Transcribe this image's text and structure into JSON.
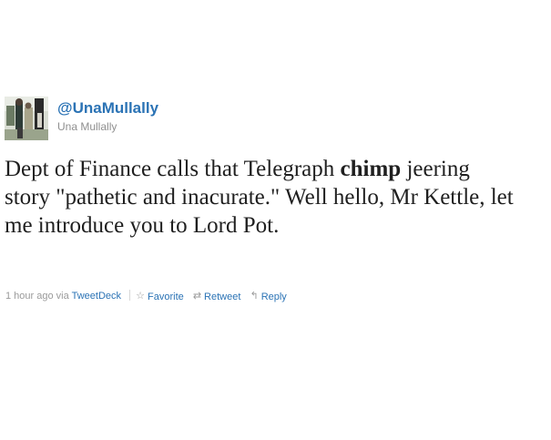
{
  "tweet": {
    "screen_name": "@UnaMullally",
    "full_name": "Una Mullally",
    "text_parts": {
      "before": "Dept of Finance calls that Telegraph ",
      "bold": "chimp",
      "after": " jeering story \"pathetic and inacurate.\" Well hello, Mr Kettle, let me introduce you to Lord Pot."
    },
    "timestamp": "1 hour ago",
    "via_label": "via",
    "source": "TweetDeck",
    "actions": {
      "favorite": "Favorite",
      "retweet": "Retweet",
      "reply": "Reply"
    }
  },
  "icons": {
    "favorite": "star-outline-icon",
    "retweet": "retweet-arrows-icon",
    "reply": "reply-arrow-icon"
  },
  "colors": {
    "link": "#2b73b5",
    "meta_gray": "#9a9a9a",
    "text": "#1f1f1f"
  }
}
